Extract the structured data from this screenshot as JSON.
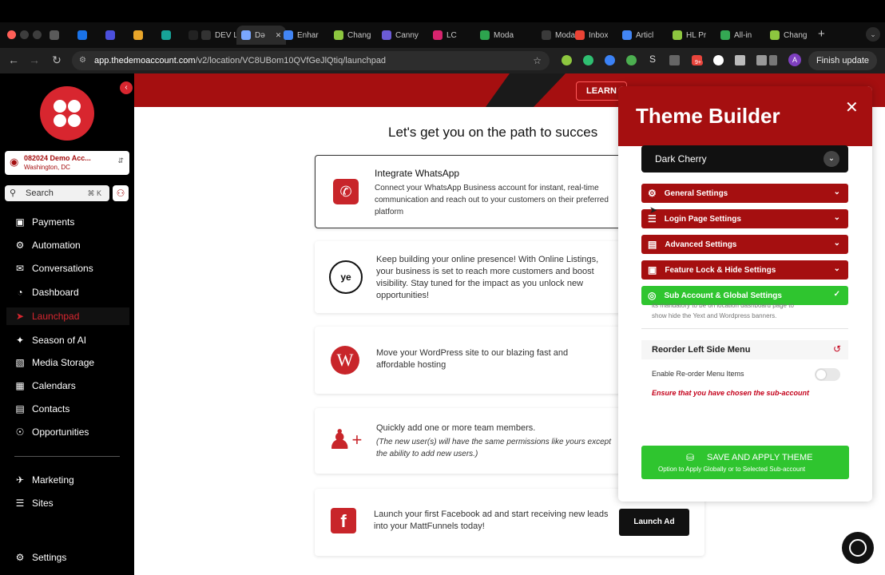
{
  "browser": {
    "tabs": [
      {
        "label": "",
        "color": "#5a5a5a"
      },
      {
        "label": "",
        "color": "#1a73e8"
      },
      {
        "label": "",
        "color": "#4b4fdc"
      },
      {
        "label": "",
        "color": "#e8a52a"
      },
      {
        "label": "",
        "color": "#17a398"
      },
      {
        "label": "B",
        "color": "#222"
      },
      {
        "label": "DEV L",
        "color": "#333"
      },
      {
        "label": "Də",
        "color": "#7aa7ff"
      },
      {
        "label": "Enhar",
        "color": "#4285f4"
      },
      {
        "label": "Chang",
        "color": "#8dc63f"
      },
      {
        "label": "Canny",
        "color": "#6b5bd6"
      },
      {
        "label": "LC",
        "color": "#d6246e"
      },
      {
        "label": "Moda",
        "color": "#2da44e"
      },
      {
        "label": "Moda",
        "color": "#3a3a3a"
      },
      {
        "label": "Inbox",
        "color": "#ea4335"
      },
      {
        "label": "Articl",
        "color": "#4285f4"
      },
      {
        "label": "HL Pr",
        "color": "#8dc63f"
      },
      {
        "label": "All-in",
        "color": "#34a853"
      },
      {
        "label": "Chang",
        "color": "#8dc63f"
      }
    ],
    "url_host": "app.thedemoaccount.com",
    "url_path": "/v2/location/VC8UBom10QVfGeJlQtiq/launchpad",
    "finish_update": "Finish update",
    "ext_badge": "9+",
    "profile_initial": "A"
  },
  "sidebar": {
    "account_name": "082024 Demo Acc...",
    "account_location": "Washington, DC",
    "search_placeholder": "Search",
    "search_shortcut": "⌘ K",
    "items": [
      {
        "label": "Payments",
        "icon": "payments-icon"
      },
      {
        "label": "Automation",
        "icon": "automation-icon"
      },
      {
        "label": "Conversations",
        "icon": "chat-icon"
      },
      {
        "label": "Dashboard",
        "icon": "dashboard-icon"
      },
      {
        "label": "Launchpad",
        "icon": "rocket-icon"
      },
      {
        "label": "Season of AI",
        "icon": "sparkle-icon"
      },
      {
        "label": "Media Storage",
        "icon": "image-icon"
      },
      {
        "label": "Calendars",
        "icon": "calendar-icon"
      },
      {
        "label": "Contacts",
        "icon": "contacts-icon"
      },
      {
        "label": "Opportunities",
        "icon": "opportunities-icon"
      }
    ],
    "lower_items": [
      {
        "label": "Marketing",
        "icon": "marketing-icon"
      },
      {
        "label": "Sites",
        "icon": "sites-icon"
      }
    ],
    "settings_label": "Settings",
    "active_color": "#d8262f"
  },
  "main": {
    "learn_label": "LEARN",
    "heading": "Let's get you on the path to succes",
    "cards": [
      {
        "title": "Integrate WhatsApp",
        "text": "Connect your WhatsApp Business account for instant, real-time communication and reach out to your customers on their preferred platform",
        "icon": "whatsapp-icon"
      },
      {
        "title": "",
        "text": "Keep building your online presence! With Online Listings, your business is set to reach more customers and boost visibility. Stay tuned for the impact as you unlock new opportunities!",
        "icon": "yext-logo"
      },
      {
        "title": "",
        "text": "Move your WordPress site to our blazing fast and affordable hosting",
        "icon": "wordpress-icon"
      },
      {
        "title": "",
        "text": "Quickly add one or more team members.",
        "note": "(The new user(s) will have the same permissions like yours except the ability to add new users.)",
        "icon": "add-user-icon"
      },
      {
        "title": "",
        "text": "Launch your first Facebook ad and start receiving new leads into your MattFunnels today!",
        "icon": "facebook-icon",
        "button": "Launch Ad"
      }
    ]
  },
  "theme_builder": {
    "title": "Theme Builder",
    "selected_theme": "Dark Cherry",
    "sections": [
      {
        "label": "General Settings",
        "icon": "gear-icon"
      },
      {
        "label": "Login Page Settings",
        "icon": "sliders-icon"
      },
      {
        "label": "Advanced Settings",
        "icon": "database-icon"
      },
      {
        "label": "Feature Lock & Hide Settings",
        "icon": "lock-icon"
      },
      {
        "label": "Sub Account & Global Settings",
        "icon": "globe-icon"
      }
    ],
    "partial_text_1": "its mandatory to be on location dashboard page to",
    "partial_text_2": "show hide the Yext and Wordpress banners.",
    "reorder_title": "Reorder Left Side Menu",
    "reorder_toggle_label": "Enable Re-order Menu Items",
    "reorder_warning": "Ensure that you have chosen the sub-account",
    "save_title": "SAVE AND APPLY THEME",
    "save_sub": "Option to Apply Globally or to Selected Sub-account",
    "colors": {
      "brand": "#a50f10",
      "success": "#2fc52f",
      "warning": "#c4001a"
    }
  }
}
